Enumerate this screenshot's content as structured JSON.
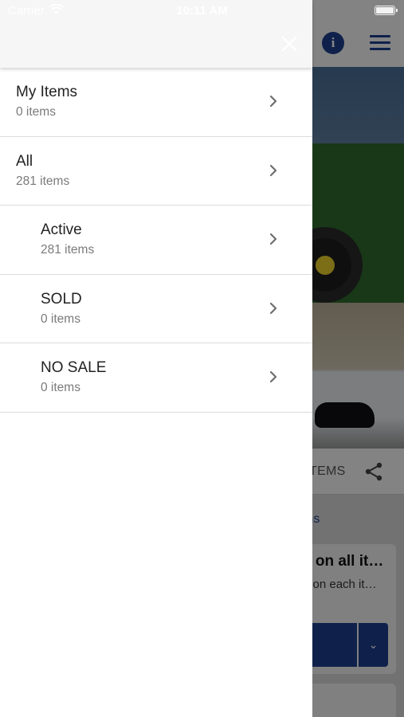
{
  "status_bar": {
    "carrier": "Carrier",
    "time": "10:11 AM"
  },
  "background": {
    "toolbar_label": "TEMS",
    "section_link": "ms",
    "card_title": "e on all it…",
    "card_subtitle": "e on each it…"
  },
  "drawer": {
    "rows": [
      {
        "title": "My Items",
        "count": "0 items"
      },
      {
        "title": "All",
        "count": "281 items"
      },
      {
        "title": "Active",
        "count": "281 items"
      },
      {
        "title": "SOLD",
        "count": "0 items"
      },
      {
        "title": "NO SALE",
        "count": "0 items"
      }
    ]
  },
  "colors": {
    "accent": "#1d3f8f",
    "divider": "#dcdcdc",
    "chevron": "#6e6e6e"
  }
}
